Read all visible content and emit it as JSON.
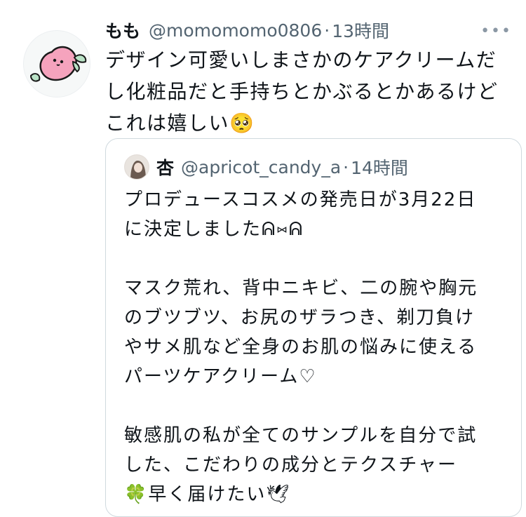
{
  "tweet": {
    "display_name": "もも",
    "handle": "@momomomo0806",
    "separator": "·",
    "time": "13時間",
    "more": "•••",
    "text": "デザイン可愛いしまさかのケアクリームだし化粧品だと手持ちとかぶるとかあるけどこれは嬉しい🥺"
  },
  "quote": {
    "display_name": "杏",
    "handle": "@apricot_candy_a",
    "separator": "·",
    "time": "14時間",
    "text": "プロデュースコスメの発売日が3月22日\nに決定しました⁠ᕱ⑅ᕱ\n\nマスク荒れ、背中ニキビ、二の腕や胸元\nのブツブツ、お尻のザラつき、剃刀負け\nやサメ肌など全身のお肌の悩みに使える\nパーツケアクリーム♡\n\n敏感肌の私が全てのサンプルを自分で試\nした、こだわりの成分とテクスチャー\n🍀早く届けたい🕊"
  },
  "icons": {
    "avatar": "peach-avatar-icon",
    "quote_avatar": "profile-photo-icon",
    "more": "more-options-icon"
  },
  "colors": {
    "text": "#0f1419",
    "secondary": "#536471",
    "border": "#cfd9de",
    "peach": "#f7a6be"
  }
}
